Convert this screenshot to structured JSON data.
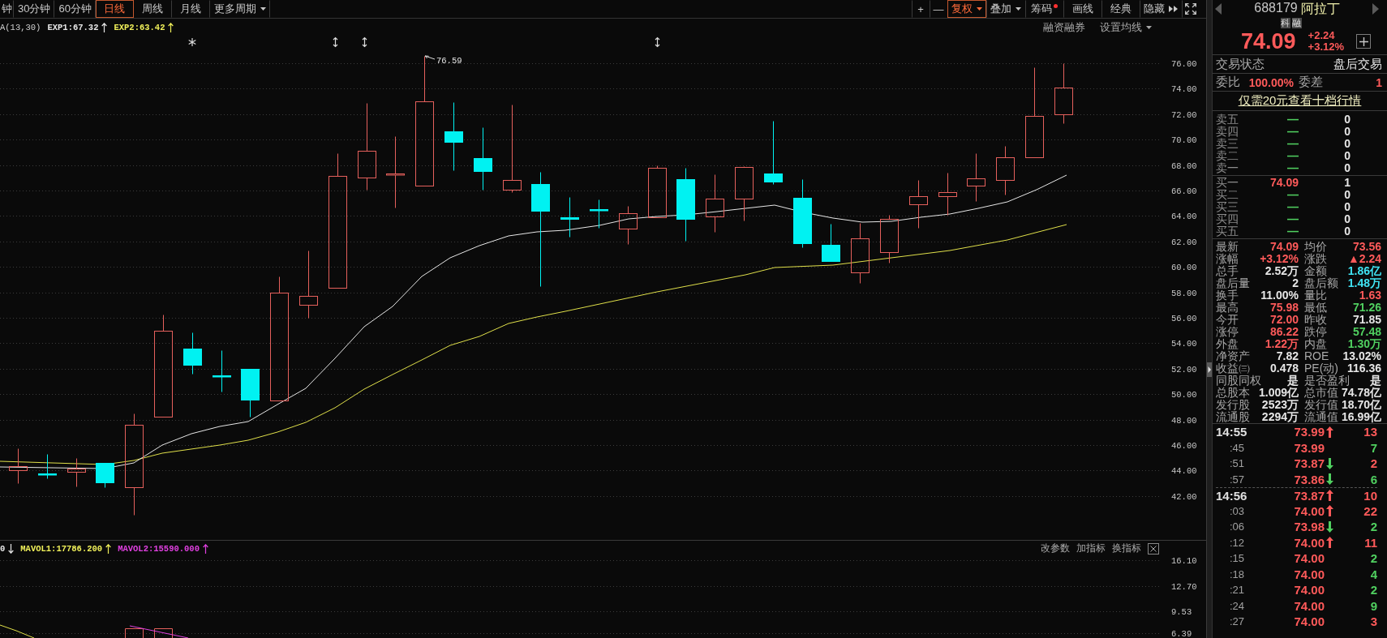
{
  "period_tabs": [
    {
      "label": "钟",
      "kind": "plain",
      "selected": false
    },
    {
      "label": "30分钟",
      "kind": "plain",
      "selected": false
    },
    {
      "label": "60分钟",
      "kind": "plain",
      "selected": false
    },
    {
      "label": "日线",
      "kind": "plain",
      "selected": true
    },
    {
      "label": "周线",
      "kind": "plain",
      "selected": false
    },
    {
      "label": "月线",
      "kind": "plain",
      "selected": false
    },
    {
      "label": "更多周期",
      "kind": "dropdown",
      "selected": false
    }
  ],
  "toolbar": [
    {
      "label": "+",
      "kind": "plain",
      "selected": false
    },
    {
      "label": "—",
      "kind": "plain",
      "selected": false
    },
    {
      "label": "复权",
      "kind": "dropdown",
      "selected": true
    },
    {
      "label": "叠加",
      "kind": "dropdown",
      "selected": false
    },
    {
      "label": "筹码",
      "kind": "dot",
      "selected": false
    },
    {
      "label": "画线",
      "kind": "plain",
      "selected": false
    },
    {
      "label": "经典",
      "kind": "plain",
      "selected": false
    },
    {
      "label": "隐藏",
      "kind": "more",
      "selected": false
    },
    {
      "kind": "fullscreen",
      "selected": false
    }
  ],
  "indicator_header": {
    "name": "A(13,30)",
    "lines": [
      {
        "text": "EXP1:67.32",
        "color": "#e6e6e6",
        "rising": true
      },
      {
        "text": "EXP2:63.42",
        "color": "#f0f05a",
        "rising": true
      }
    ]
  },
  "chart_links": [
    {
      "label": "融资融券",
      "kind": "plain"
    },
    {
      "label": "设置均线",
      "kind": "dropdown"
    }
  ],
  "price_axis": [
    "76.00",
    "74.00",
    "72.00",
    "70.00",
    "68.00",
    "66.00",
    "64.00",
    "62.00",
    "60.00",
    "58.00",
    "56.00",
    "54.00",
    "52.00",
    "50.00",
    "48.00",
    "46.00",
    "44.00",
    "42.00"
  ],
  "high_label": "76.59",
  "volume_header": {
    "lines": [
      {
        "text": "0",
        "color": "#e6e6e6",
        "rising": false
      },
      {
        "text": "MAVOL1:17786.200",
        "color": "#f0f05a",
        "rising": true
      },
      {
        "text": "MAVOL2:15590.000",
        "color": "#e040e0",
        "rising": true
      }
    ]
  },
  "volume_actions": [
    "改参数",
    "加指标",
    "换指标"
  ],
  "volume_axis": [
    "16.10",
    "12.70",
    "9.53",
    "6.39"
  ],
  "quote": {
    "code": "688179",
    "name": "阿拉丁",
    "badges": [
      "科",
      "融"
    ],
    "price": "74.09",
    "change": "+2.24",
    "change_percent": "+3.12%"
  },
  "trade_status": {
    "label": "交易状态",
    "value": "盘后交易"
  },
  "order_ratio": {
    "label": "委比",
    "value": "100.00%",
    "diff_label": "委差",
    "diff_value": "1"
  },
  "promo_link": "仅需20元查看十档行情",
  "asks": [
    {
      "label": "卖五",
      "price": "—",
      "color": "#50d060",
      "volume": "0"
    },
    {
      "label": "卖四",
      "price": "—",
      "color": "#50d060",
      "volume": "0"
    },
    {
      "label": "卖三",
      "price": "—",
      "color": "#50d060",
      "volume": "0"
    },
    {
      "label": "卖二",
      "price": "—",
      "color": "#50d060",
      "volume": "0"
    },
    {
      "label": "卖一",
      "price": "—",
      "color": "#50d060",
      "volume": "0"
    }
  ],
  "bids": [
    {
      "label": "买一",
      "price": "74.09",
      "color": "#ff5a5a",
      "volume": "1"
    },
    {
      "label": "买二",
      "price": "—",
      "color": "#50d060",
      "volume": "0"
    },
    {
      "label": "买三",
      "price": "—",
      "color": "#50d060",
      "volume": "0"
    },
    {
      "label": "买四",
      "price": "—",
      "color": "#50d060",
      "volume": "0"
    },
    {
      "label": "买五",
      "price": "—",
      "color": "#50d060",
      "volume": "0"
    }
  ],
  "stats": [
    {
      "label": "最新",
      "value": "74.09",
      "color": "#ff5a5a"
    },
    {
      "label": "均价",
      "value": "73.56",
      "color": "#ff5a5a"
    },
    {
      "label": "涨幅",
      "value": "+3.12%",
      "color": "#ff5a5a"
    },
    {
      "label": "涨跌",
      "value": "▲2.24",
      "color": "#ff5a5a"
    },
    {
      "label": "总手",
      "value": "2.52万",
      "color": "#e6e6e6"
    },
    {
      "label": "金额",
      "value": "1.86亿",
      "color": "#40e4f4"
    },
    {
      "label": "盘后量",
      "value": "2",
      "color": "#e6e6e6"
    },
    {
      "label": "盘后额",
      "value": "1.48万",
      "color": "#40e4f4"
    },
    {
      "label": "换手",
      "value": "11.00%",
      "color": "#e6e6e6"
    },
    {
      "label": "量比",
      "value": "1.63",
      "color": "#ff5a5a"
    },
    {
      "label": "最高",
      "value": "75.98",
      "color": "#ff5a5a"
    },
    {
      "label": "最低",
      "value": "71.26",
      "color": "#50d060"
    },
    {
      "label": "今开",
      "value": "72.00",
      "color": "#ff5a5a"
    },
    {
      "label": "昨收",
      "value": "71.85",
      "color": "#e6e6e6"
    },
    {
      "label": "涨停",
      "value": "86.22",
      "color": "#ff5a5a"
    },
    {
      "label": "跌停",
      "value": "57.48",
      "color": "#50d060"
    },
    {
      "label": "外盘",
      "value": "1.22万",
      "color": "#ff5a5a"
    },
    {
      "label": "内盘",
      "value": "1.30万",
      "color": "#50d060"
    },
    {
      "label": "净资产",
      "value": "7.82",
      "color": "#e6e6e6"
    },
    {
      "label": "ROE",
      "value": "13.02%",
      "color": "#e6e6e6"
    },
    {
      "label": "收益㈢",
      "value": "0.478",
      "color": "#e6e6e6"
    },
    {
      "label": "PE(动)",
      "value": "116.36",
      "color": "#e6e6e6"
    },
    {
      "label": "同股同权",
      "value": "是",
      "color": "#e6e6e6"
    },
    {
      "label": "是否盈利",
      "value": "是",
      "color": "#e6e6e6"
    },
    {
      "label": "总股本",
      "value": "1.009亿",
      "color": "#e6e6e6"
    },
    {
      "label": "总市值",
      "value": "74.78亿",
      "color": "#e6e6e6"
    },
    {
      "label": "发行股",
      "value": "2523万",
      "color": "#e6e6e6"
    },
    {
      "label": "发行值",
      "value": "18.70亿",
      "color": "#e6e6e6"
    },
    {
      "label": "流通股",
      "value": "2294万",
      "color": "#e6e6e6"
    },
    {
      "label": "流通值",
      "value": "16.99亿",
      "color": "#e6e6e6"
    }
  ],
  "ticks": [
    {
      "time": "14:55",
      "kind": "minute",
      "price": "73.99",
      "uptick": true,
      "downtick": false,
      "volume": "13",
      "color": "#ff5a5a"
    },
    {
      "time": ":45",
      "kind": "second",
      "price": "73.99",
      "uptick": false,
      "downtick": false,
      "volume": "7",
      "color": "#50d060"
    },
    {
      "time": ":51",
      "kind": "second",
      "price": "73.87",
      "uptick": false,
      "downtick": true,
      "volume": "2",
      "color": "#ff5a5a"
    },
    {
      "time": ":57",
      "kind": "second",
      "price": "73.86",
      "uptick": false,
      "downtick": true,
      "volume": "6",
      "color": "#50d060"
    },
    {
      "time": "14:56",
      "kind": "minute",
      "price": "73.87",
      "uptick": true,
      "downtick": false,
      "volume": "10",
      "color": "#ff5a5a"
    },
    {
      "time": ":03",
      "kind": "second",
      "price": "74.00",
      "uptick": true,
      "downtick": false,
      "volume": "22",
      "color": "#ff5a5a"
    },
    {
      "time": ":06",
      "kind": "second",
      "price": "73.98",
      "uptick": false,
      "downtick": true,
      "volume": "2",
      "color": "#50d060"
    },
    {
      "time": ":12",
      "kind": "second",
      "price": "74.00",
      "uptick": true,
      "downtick": false,
      "volume": "11",
      "color": "#ff5a5a"
    },
    {
      "time": ":15",
      "kind": "second",
      "price": "74.00",
      "uptick": false,
      "downtick": false,
      "volume": "2",
      "color": "#50d060"
    },
    {
      "time": ":18",
      "kind": "second",
      "price": "74.00",
      "uptick": false,
      "downtick": false,
      "volume": "4",
      "color": "#50d060"
    },
    {
      "time": ":21",
      "kind": "second",
      "price": "74.00",
      "uptick": false,
      "downtick": false,
      "volume": "2",
      "color": "#50d060"
    },
    {
      "time": ":24",
      "kind": "second",
      "price": "74.00",
      "uptick": false,
      "downtick": false,
      "volume": "9",
      "color": "#50d060"
    },
    {
      "time": ":27",
      "kind": "second",
      "price": "74.00",
      "uptick": false,
      "downtick": false,
      "volume": "3",
      "color": "#ff5a5a"
    }
  ]
}
